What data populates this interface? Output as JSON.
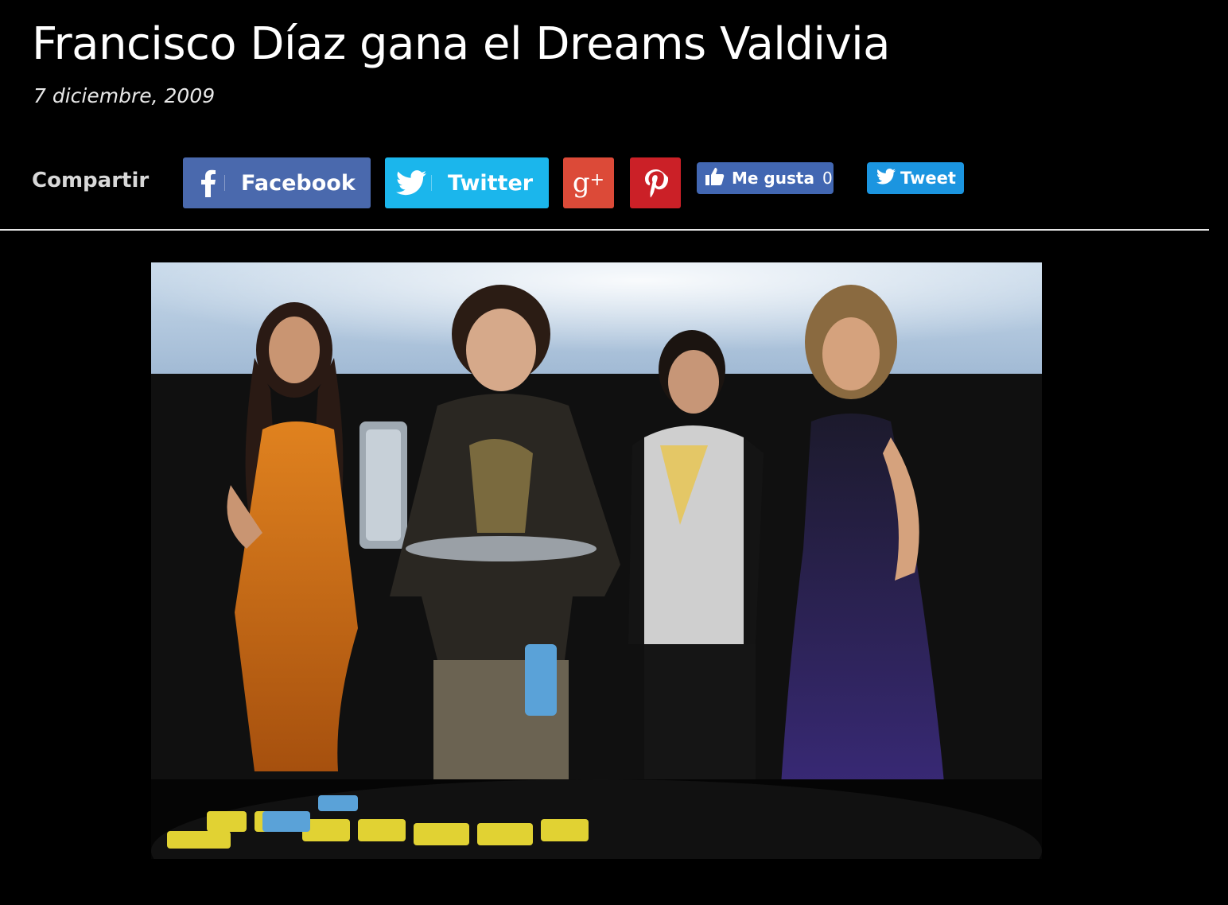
{
  "article": {
    "title": "Francisco Díaz gana el Dreams Valdivia",
    "date": "7 diciembre, 2009",
    "body_preview": ""
  },
  "share": {
    "label": "Compartir",
    "facebook_label": "Facebook",
    "twitter_label": "Twitter",
    "like_label": "Me gusta",
    "like_count": "0",
    "tweet_label": "Tweet",
    "icons": [
      "facebook-icon",
      "twitter-icon",
      "google-plus-icon",
      "pinterest-icon",
      "thumbs-up-icon",
      "twitter-icon"
    ]
  },
  "colors": {
    "background": "#000000",
    "facebook": "#4a69ad",
    "twitter": "#1bb6ec",
    "google_plus": "#dc4a38",
    "pinterest": "#cb2027",
    "like_button": "#4267b2",
    "tweet_button": "#1b95e0"
  }
}
